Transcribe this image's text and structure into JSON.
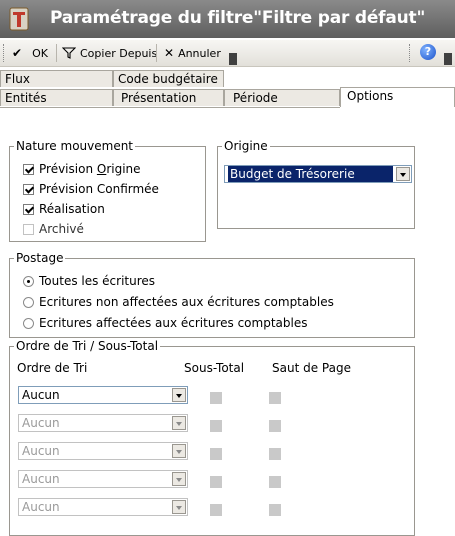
{
  "window": {
    "title": "Paramétrage du filtre\"Filtre par défaut\""
  },
  "toolbar": {
    "ok_label": "OK",
    "copy_label": "Copier Depuis",
    "cancel_label": "Annuler"
  },
  "tabs": {
    "row1": [
      "Flux",
      "Code budgétaire"
    ],
    "row2": [
      "Entités",
      "Présentation",
      "Période",
      "Options"
    ],
    "active": "Options"
  },
  "nature": {
    "legend": "Nature mouvement",
    "items": [
      {
        "label": "Prévision Origine",
        "checked": true
      },
      {
        "label": "Prévision Confirmée",
        "checked": true
      },
      {
        "label": "Réalisation",
        "checked": true
      },
      {
        "label": "Archivé",
        "checked": false
      }
    ]
  },
  "origine": {
    "legend": "Origine",
    "selected": "Budget de Trésorerie"
  },
  "postage": {
    "legend": "Postage",
    "options": [
      {
        "label": "Toutes les écritures",
        "selected": true
      },
      {
        "label": "Ecritures non affectées aux écritures comptables",
        "selected": false
      },
      {
        "label": "Ecritures affectées aux écritures comptables",
        "selected": false
      }
    ]
  },
  "sort": {
    "legend": "Ordre de Tri / Sous-Total",
    "headers": {
      "order": "Ordre de Tri",
      "subtotal": "Sous-Total",
      "pagebreak": "Saut de Page"
    },
    "rows": [
      {
        "value": "Aucun",
        "enabled": true
      },
      {
        "value": "Aucun",
        "enabled": false
      },
      {
        "value": "Aucun",
        "enabled": false
      },
      {
        "value": "Aucun",
        "enabled": false
      },
      {
        "value": "Aucun",
        "enabled": false
      }
    ]
  }
}
